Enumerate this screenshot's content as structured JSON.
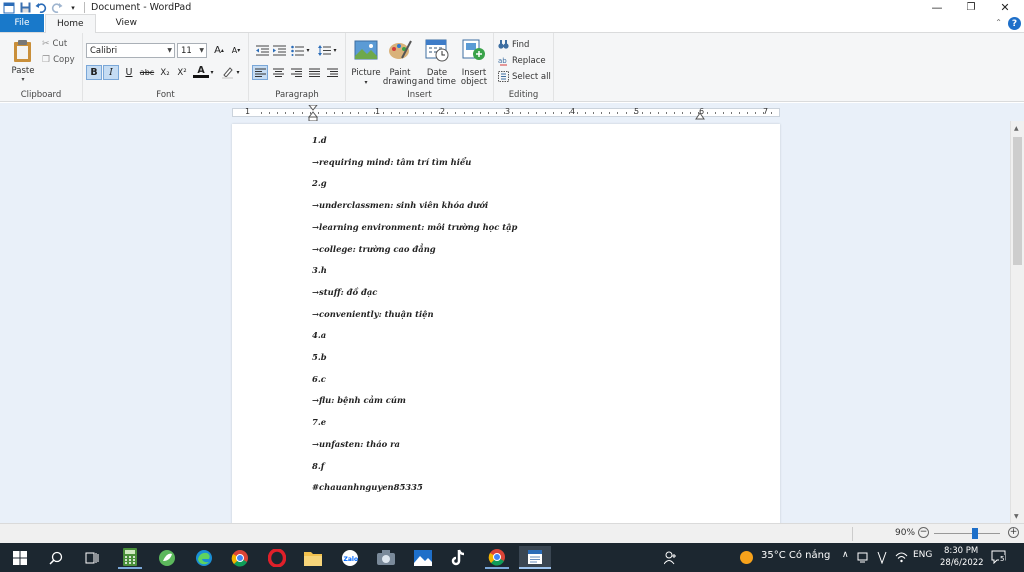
{
  "window": {
    "title": "Document - WordPad",
    "controls": {
      "minimize": "—",
      "restore": "❐",
      "close": "✕"
    }
  },
  "tabs": {
    "file": "File",
    "home": "Home",
    "view": "View"
  },
  "ribbon": {
    "clipboard": {
      "group": "Clipboard",
      "paste": "Paste",
      "cut": "Cut",
      "copy": "Copy"
    },
    "font": {
      "group": "Font",
      "family": "Calibri",
      "size": "11",
      "bold": "B",
      "italic": "I",
      "underline": "U",
      "strike": "abc",
      "subscript": "X₂",
      "superscript": "X²",
      "grow": "A",
      "shrink": "A",
      "color": "A"
    },
    "paragraph": {
      "group": "Paragraph"
    },
    "insert": {
      "group": "Insert",
      "picture": "Picture",
      "paint": "Paint drawing",
      "datetime": "Date and time",
      "object": "Insert object"
    },
    "editing": {
      "group": "Editing",
      "find": "Find",
      "replace": "Replace",
      "selectall": "Select all"
    }
  },
  "ruler": {
    "numbers": [
      "1",
      "1",
      "2",
      "3",
      "4",
      "5",
      "6",
      "7"
    ]
  },
  "document": {
    "lines": [
      "1.d",
      "→requiring mind: tâm trí tìm hiểu",
      "2.g",
      "→underclassmen:  sinh viên khóa dưới",
      "→learning  environment: môi trường học tập",
      "→college:  trường cao đẳng",
      "3.h",
      "→stuff: đồ đạc",
      "→conveniently:  thuận tiện",
      "4.a",
      "5.b",
      "6.c",
      "→flu: bệnh cảm cúm",
      "7.e",
      "→unfasten: tháo ra",
      "8.f",
      "#chauanhnguyen85335"
    ]
  },
  "status": {
    "zoom": "90%",
    "zoom_level": 0.62
  },
  "taskbar": {
    "weather": "35°C  Có nắng",
    "language": "ENG",
    "time": "8:30 PM",
    "date": "28/6/2022",
    "notifications": "5"
  },
  "colors": {
    "file_tab": "#1979ca",
    "taskbar": "#1c2730",
    "doc_bg": "#e9f0f9"
  }
}
